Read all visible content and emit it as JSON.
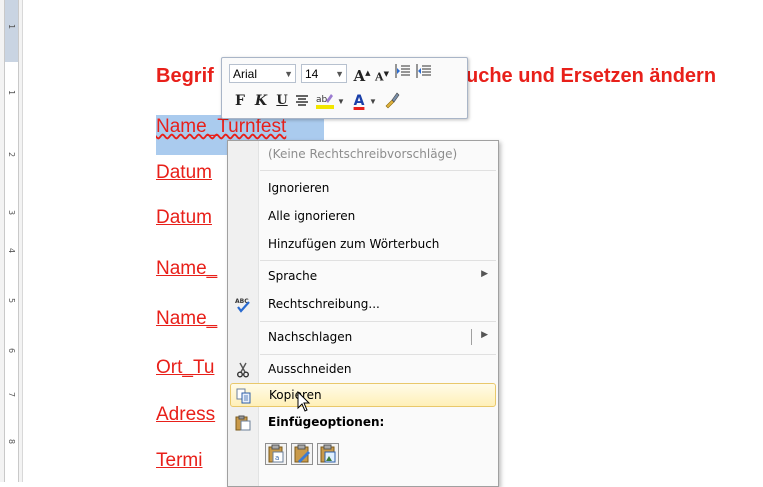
{
  "ruler": {
    "labels": [
      "1",
      "1",
      "2",
      "3",
      "4",
      "5",
      "6",
      "7",
      "8"
    ]
  },
  "document": {
    "heading_left": "Begrif",
    "heading_right": "uche und Ersetzen ändern",
    "selected_line": "Name_Turnfest",
    "lines": [
      "Datum",
      "Datum",
      "Name_",
      "Name_",
      "Ort_Tu",
      "Adress",
      "Termi"
    ]
  },
  "mini_toolbar": {
    "font": "Arial",
    "size": "14",
    "grow_font": "A",
    "shrink_font": "A",
    "bold": "F",
    "italic": "K",
    "underline": "U",
    "font_color_letter": "A",
    "colors": {
      "highlight": "#f2e600",
      "font_color": "#e8201a"
    }
  },
  "context_menu": {
    "no_suggestions": "(Keine Rechtschreibvorschläge)",
    "ignore": "Ignorieren",
    "ignore_all": "Alle ignorieren",
    "add_to_dictionary": "Hinzufügen zum Wörterbuch",
    "language": "Sprache",
    "spelling": "Rechtschreibung...",
    "lookup": "Nachschlagen",
    "cut": "Ausschneiden",
    "copy": "Kopieren",
    "paste_options": "Einfügeoptionen:"
  }
}
